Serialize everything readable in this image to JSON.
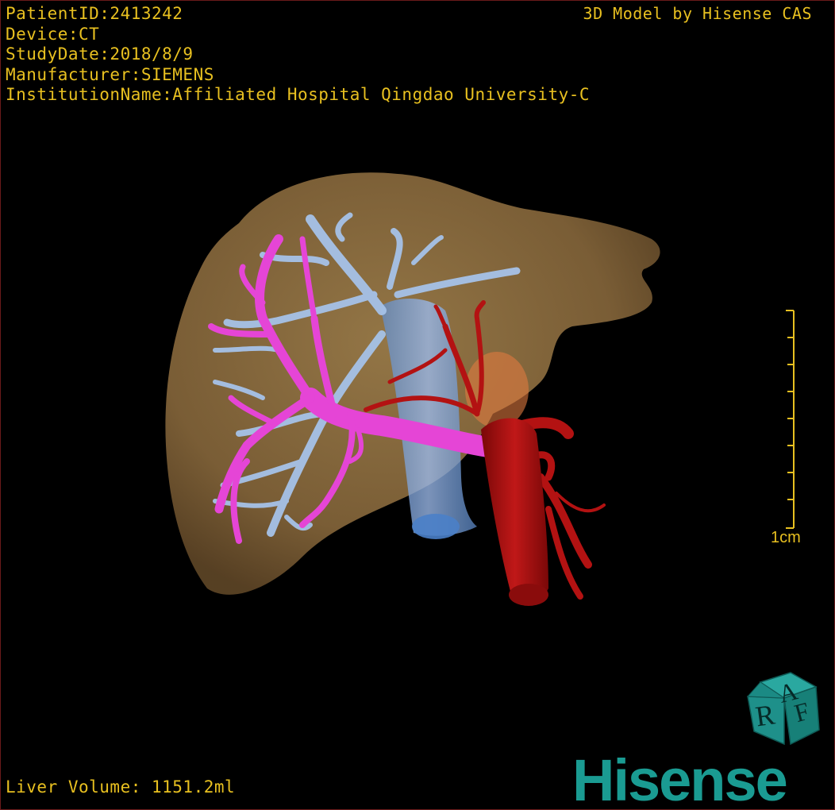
{
  "patient": {
    "id_line": "PatientID:2413242",
    "device_line": "Device:CT",
    "date_line": "StudyDate:2018/8/9",
    "manufacturer_line": "Manufacturer:SIEMENS",
    "institution_line": "InstitutionName:Affiliated Hospital Qingdao University-C"
  },
  "header": {
    "model_credit": "3D Model by Hisense CAS"
  },
  "footer": {
    "volume": "Liver Volume: 1151.2ml"
  },
  "scale_bar": {
    "label": "1cm",
    "color": "#e8c020"
  },
  "orientation_cube": {
    "face_top": "A",
    "face_left": "R",
    "face_front": "F",
    "color": "#1a9b92"
  },
  "logo": {
    "text": "Hisense",
    "color": "#1a9b92"
  },
  "model": {
    "liver_color": "#8a6a3e",
    "portal_vein_color": "#e040d0",
    "hepatic_vein_color": "#9ab8e0",
    "ivc_color": "#6a98d8",
    "artery_color": "#b01010",
    "gallbladder_color": "#e07a40"
  }
}
